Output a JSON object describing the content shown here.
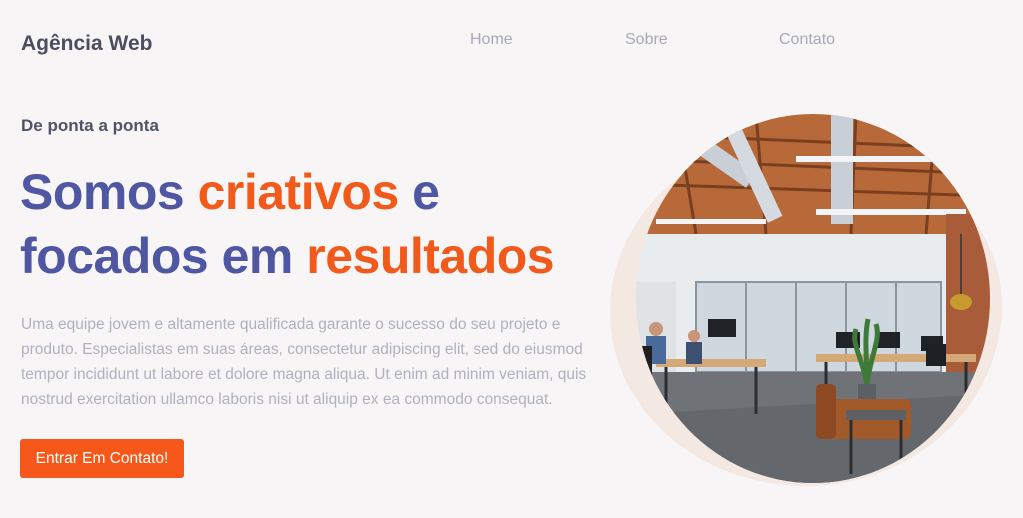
{
  "header": {
    "logo": "Agência Web",
    "nav": [
      {
        "label": "Home"
      },
      {
        "label": "Sobre"
      },
      {
        "label": "Contato"
      }
    ]
  },
  "hero": {
    "eyebrow": "De ponta a ponta",
    "headline": {
      "part1": "Somos ",
      "part2": "criativos",
      "part3": " e",
      "part4": "focados em ",
      "part5": "resultados"
    },
    "description": "Uma equipe jovem e altamente qualificada garante o sucesso do seu projeto e produto. Especialistas em suas áreas, consectetur adipiscing elit, sed do eiusmod tempor incididunt ut labore et dolore magna aliqua. Ut enim ad minim veniam, quis nostrud exercitation ullamco laboris nisi ut aliquip ex ea commodo consequat.",
    "cta_label": "Entrar Em Contato!"
  },
  "colors": {
    "background": "#f7f5f6",
    "primary": "#4f57a3",
    "accent": "#f25a1c",
    "muted_text": "#aeb2bf",
    "blob": "#f4e8e2"
  }
}
